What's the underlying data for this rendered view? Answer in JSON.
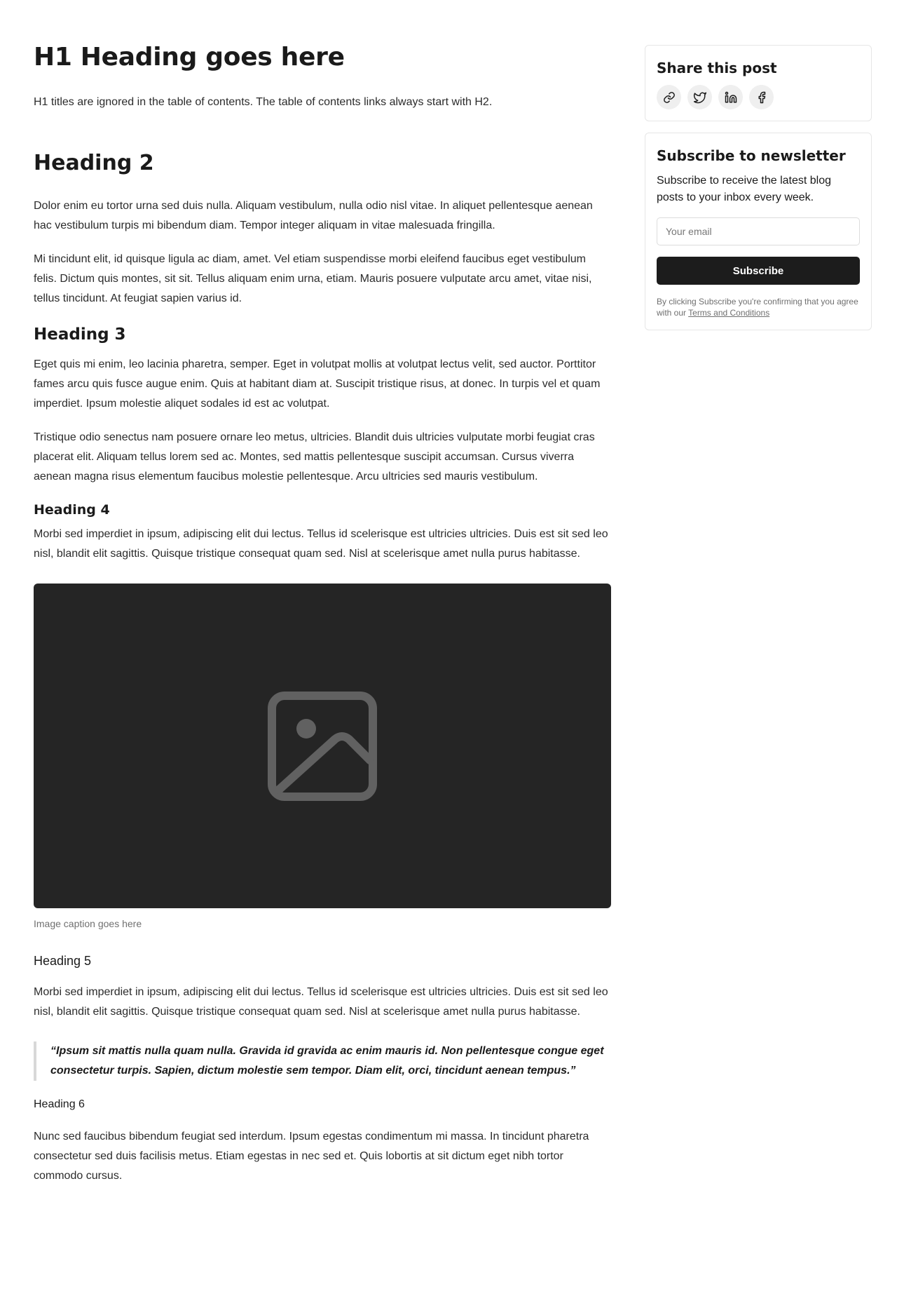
{
  "article": {
    "h1": "H1 Heading goes here",
    "intro": "H1 titles are ignored in the table of contents. The table of contents links always start with H2.",
    "h2": "Heading 2",
    "h2_p1": "Dolor enim eu tortor urna sed duis nulla. Aliquam vestibulum, nulla odio nisl vitae. In aliquet pellentesque aenean hac vestibulum turpis mi bibendum diam. Tempor integer aliquam in vitae malesuada fringilla.",
    "h2_p2": "Mi tincidunt elit, id quisque ligula ac diam, amet. Vel etiam suspendisse morbi eleifend faucibus eget vestibulum felis. Dictum quis montes, sit sit. Tellus aliquam enim urna, etiam. Mauris posuere vulputate arcu amet, vitae nisi, tellus tincidunt. At feugiat sapien varius id.",
    "h3": "Heading 3",
    "h3_p1": "Eget quis mi enim, leo lacinia pharetra, semper. Eget in volutpat mollis at volutpat lectus velit, sed auctor. Porttitor fames arcu quis fusce augue enim. Quis at habitant diam at. Suscipit tristique risus, at donec. In turpis vel et quam imperdiet. Ipsum molestie aliquet sodales id est ac volutpat.",
    "h3_p2": "Tristique odio senectus nam posuere ornare leo metus, ultricies. Blandit duis ultricies vulputate morbi feugiat cras placerat elit. Aliquam tellus lorem sed ac. Montes, sed mattis pellentesque suscipit accumsan. Cursus viverra aenean magna risus elementum faucibus molestie pellentesque. Arcu ultricies sed mauris vestibulum.",
    "h4": "Heading 4",
    "h4_p1": "Morbi sed imperdiet in ipsum, adipiscing elit dui lectus. Tellus id scelerisque est ultricies ultricies. Duis est sit sed leo nisl, blandit elit sagittis. Quisque tristique consequat quam sed. Nisl at scelerisque amet nulla purus habitasse.",
    "image_icon": "image-placeholder-icon",
    "caption": "Image caption goes here",
    "h5": "Heading 5",
    "h5_p1": "Morbi sed imperdiet in ipsum, adipiscing elit dui lectus. Tellus id scelerisque est ultricies ultricies. Duis est sit sed leo nisl, blandit elit sagittis. Quisque tristique consequat quam sed. Nisl at scelerisque amet nulla purus habitasse.",
    "quote": "“Ipsum sit mattis nulla quam nulla. Gravida id gravida ac enim mauris id. Non pellentesque congue eget consectetur turpis. Sapien, dictum molestie sem tempor. Diam elit, orci, tincidunt aenean tempus.”",
    "h6": "Heading 6",
    "h6_p1": "Nunc sed faucibus bibendum feugiat sed interdum. Ipsum egestas condimentum mi massa. In tincidunt pharetra consectetur sed duis facilisis metus. Etiam egestas in nec sed et. Quis lobortis at sit dictum eget nibh tortor commodo cursus."
  },
  "share": {
    "title": "Share this post",
    "buttons": [
      "link-icon",
      "twitter-icon",
      "linkedin-icon",
      "facebook-icon"
    ]
  },
  "newsletter": {
    "title": "Subscribe to newsletter",
    "description": "Subscribe to receive the latest blog posts to your inbox every week.",
    "email_placeholder": "Your email",
    "button": "Subscribe",
    "legal_prefix": "By clicking Subscribe you're confirming that you agree with our ",
    "legal_link": "Terms and Conditions"
  },
  "colors": {
    "background": "#ffffff",
    "text": "#1a1a1a",
    "image_bg": "#252525",
    "button_bg": "#1c1c1c",
    "icon_bg": "#efefef",
    "border": "#e6e6e6"
  }
}
